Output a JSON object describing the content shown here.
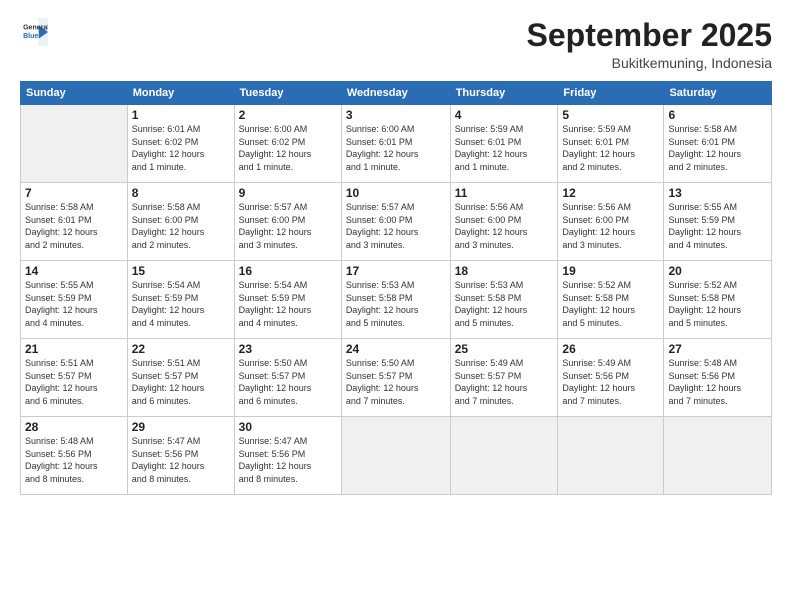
{
  "header": {
    "logo_line1": "General",
    "logo_line2": "Blue",
    "month": "September 2025",
    "location": "Bukitkemuning, Indonesia"
  },
  "weekdays": [
    "Sunday",
    "Monday",
    "Tuesday",
    "Wednesday",
    "Thursday",
    "Friday",
    "Saturday"
  ],
  "weeks": [
    [
      {
        "day": "",
        "info": ""
      },
      {
        "day": "1",
        "info": "Sunrise: 6:01 AM\nSunset: 6:02 PM\nDaylight: 12 hours\nand 1 minute."
      },
      {
        "day": "2",
        "info": "Sunrise: 6:00 AM\nSunset: 6:02 PM\nDaylight: 12 hours\nand 1 minute."
      },
      {
        "day": "3",
        "info": "Sunrise: 6:00 AM\nSunset: 6:01 PM\nDaylight: 12 hours\nand 1 minute."
      },
      {
        "day": "4",
        "info": "Sunrise: 5:59 AM\nSunset: 6:01 PM\nDaylight: 12 hours\nand 1 minute."
      },
      {
        "day": "5",
        "info": "Sunrise: 5:59 AM\nSunset: 6:01 PM\nDaylight: 12 hours\nand 2 minutes."
      },
      {
        "day": "6",
        "info": "Sunrise: 5:58 AM\nSunset: 6:01 PM\nDaylight: 12 hours\nand 2 minutes."
      }
    ],
    [
      {
        "day": "7",
        "info": "Sunrise: 5:58 AM\nSunset: 6:01 PM\nDaylight: 12 hours\nand 2 minutes."
      },
      {
        "day": "8",
        "info": "Sunrise: 5:58 AM\nSunset: 6:00 PM\nDaylight: 12 hours\nand 2 minutes."
      },
      {
        "day": "9",
        "info": "Sunrise: 5:57 AM\nSunset: 6:00 PM\nDaylight: 12 hours\nand 3 minutes."
      },
      {
        "day": "10",
        "info": "Sunrise: 5:57 AM\nSunset: 6:00 PM\nDaylight: 12 hours\nand 3 minutes."
      },
      {
        "day": "11",
        "info": "Sunrise: 5:56 AM\nSunset: 6:00 PM\nDaylight: 12 hours\nand 3 minutes."
      },
      {
        "day": "12",
        "info": "Sunrise: 5:56 AM\nSunset: 6:00 PM\nDaylight: 12 hours\nand 3 minutes."
      },
      {
        "day": "13",
        "info": "Sunrise: 5:55 AM\nSunset: 5:59 PM\nDaylight: 12 hours\nand 4 minutes."
      }
    ],
    [
      {
        "day": "14",
        "info": "Sunrise: 5:55 AM\nSunset: 5:59 PM\nDaylight: 12 hours\nand 4 minutes."
      },
      {
        "day": "15",
        "info": "Sunrise: 5:54 AM\nSunset: 5:59 PM\nDaylight: 12 hours\nand 4 minutes."
      },
      {
        "day": "16",
        "info": "Sunrise: 5:54 AM\nSunset: 5:59 PM\nDaylight: 12 hours\nand 4 minutes."
      },
      {
        "day": "17",
        "info": "Sunrise: 5:53 AM\nSunset: 5:58 PM\nDaylight: 12 hours\nand 5 minutes."
      },
      {
        "day": "18",
        "info": "Sunrise: 5:53 AM\nSunset: 5:58 PM\nDaylight: 12 hours\nand 5 minutes."
      },
      {
        "day": "19",
        "info": "Sunrise: 5:52 AM\nSunset: 5:58 PM\nDaylight: 12 hours\nand 5 minutes."
      },
      {
        "day": "20",
        "info": "Sunrise: 5:52 AM\nSunset: 5:58 PM\nDaylight: 12 hours\nand 5 minutes."
      }
    ],
    [
      {
        "day": "21",
        "info": "Sunrise: 5:51 AM\nSunset: 5:57 PM\nDaylight: 12 hours\nand 6 minutes."
      },
      {
        "day": "22",
        "info": "Sunrise: 5:51 AM\nSunset: 5:57 PM\nDaylight: 12 hours\nand 6 minutes."
      },
      {
        "day": "23",
        "info": "Sunrise: 5:50 AM\nSunset: 5:57 PM\nDaylight: 12 hours\nand 6 minutes."
      },
      {
        "day": "24",
        "info": "Sunrise: 5:50 AM\nSunset: 5:57 PM\nDaylight: 12 hours\nand 7 minutes."
      },
      {
        "day": "25",
        "info": "Sunrise: 5:49 AM\nSunset: 5:57 PM\nDaylight: 12 hours\nand 7 minutes."
      },
      {
        "day": "26",
        "info": "Sunrise: 5:49 AM\nSunset: 5:56 PM\nDaylight: 12 hours\nand 7 minutes."
      },
      {
        "day": "27",
        "info": "Sunrise: 5:48 AM\nSunset: 5:56 PM\nDaylight: 12 hours\nand 7 minutes."
      }
    ],
    [
      {
        "day": "28",
        "info": "Sunrise: 5:48 AM\nSunset: 5:56 PM\nDaylight: 12 hours\nand 8 minutes."
      },
      {
        "day": "29",
        "info": "Sunrise: 5:47 AM\nSunset: 5:56 PM\nDaylight: 12 hours\nand 8 minutes."
      },
      {
        "day": "30",
        "info": "Sunrise: 5:47 AM\nSunset: 5:56 PM\nDaylight: 12 hours\nand 8 minutes."
      },
      {
        "day": "",
        "info": ""
      },
      {
        "day": "",
        "info": ""
      },
      {
        "day": "",
        "info": ""
      },
      {
        "day": "",
        "info": ""
      }
    ]
  ]
}
